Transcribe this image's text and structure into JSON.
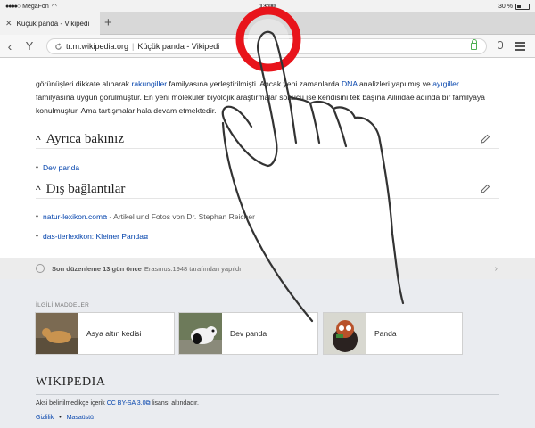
{
  "status_bar": {
    "carrier": "MegaFon",
    "time": "13:00",
    "battery": "30 %"
  },
  "tab": {
    "title": "Küçük panda - Vikipedi",
    "close": "✕",
    "new": "+"
  },
  "address": {
    "back": "‹",
    "y_icon": "Y",
    "domain": "tr.m.wikipedia.org",
    "separator": "|",
    "page_title": "Küçük panda - Vikipedi"
  },
  "intro": {
    "p1": "görünüşleri dikkate alınarak ",
    "link1": "rakungiller",
    "p2": " familyasına yerleştirilmişti. Ancak yeni zamanlarda ",
    "link2": "DNA",
    "p3": " analizleri yapılmış ve ",
    "link3": "ayıgiller",
    "p4": " familyasına uygun görülmüştür. En yeni moleküler biyolojik araştırmalar sonucu ise kendisini tek başına Ailiridae adında bir familyaya konulmuştur. Ama tartışmalar hala devam etmektedir."
  },
  "sections": {
    "see_also": {
      "title": "Ayrıca bakınız",
      "caret": "^",
      "items": [
        "Dev panda"
      ]
    },
    "external": {
      "title": "Dış bağlantılar",
      "caret": "^",
      "link1": "natur-lexikon.com",
      "link1_rest": " - Artikel und Fotos von Dr. Stephan Reicher",
      "link2": "das-tierlexikon: Kleiner Panda",
      "ext": "⧉"
    }
  },
  "last_edit": {
    "bold": "Son düzenleme 13 gün önce",
    "rest": "Erasmus.1948 tarafından yapıldı",
    "chevron": "›"
  },
  "related": {
    "heading": "İLGİLİ MADDELER",
    "cards": [
      {
        "label": "Asya altın kedisi"
      },
      {
        "label": "Dev panda"
      },
      {
        "label": "Panda"
      }
    ]
  },
  "footer": {
    "logo": "WIKIPEDIA",
    "license_pre": "Aksi belirtilmedikçe içerik ",
    "license_link": "CC BY-SA 3.0",
    "license_post": " lisansı altındadır.",
    "privacy": "Gizlilik",
    "dot": "•",
    "desktop": "Masaüstü"
  },
  "colors": {
    "link": "#0645ad",
    "touch_ring": "#e8141b",
    "secure": "#4caf50"
  }
}
